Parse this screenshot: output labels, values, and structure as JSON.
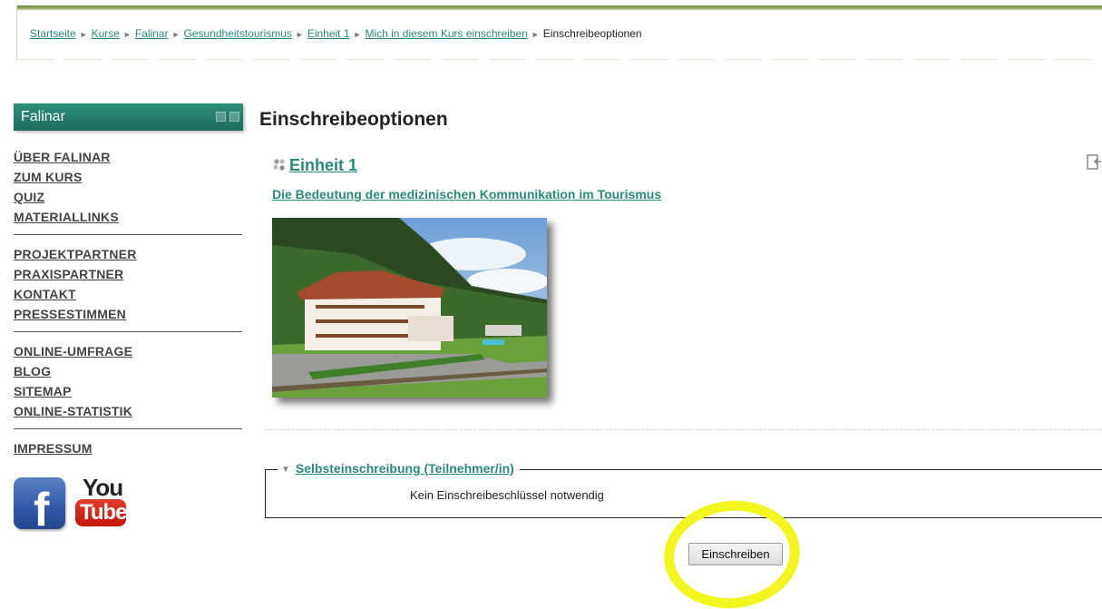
{
  "breadcrumb": {
    "items": [
      "Startseite",
      "Kurse",
      "Falinar",
      "Gesundheitstourismus",
      "Einheit 1",
      "Mich in diesem Kurs einschreiben"
    ],
    "current": "Einschreibeoptionen",
    "separator": "►"
  },
  "sidebar": {
    "title": "Falinar",
    "groups": [
      [
        "ÜBER FALINAR",
        "ZUM KURS",
        "QUIZ",
        "MATERIALLINKS"
      ],
      [
        "PROJEKTPARTNER",
        "PRAXISPARTNER",
        "KONTAKT",
        "PRESSESTIMMEN"
      ],
      [
        "ONLINE-UMFRAGE",
        "BLOG",
        "SITEMAP",
        "ONLINE-STATISTIK"
      ],
      [
        "IMPRESSUM"
      ]
    ],
    "social": {
      "facebook_letter": "f",
      "youtube_you": "You",
      "youtube_tube": "Tube",
      "facebook_icon": "facebook-icon",
      "youtube_icon": "youtube-icon"
    }
  },
  "main": {
    "title": "Einschreibeoptionen",
    "course": {
      "name": "Einheit 1",
      "summary": "Die Bedeutung der medizinischen Kommunikation im Tourismus",
      "icon": "course-icon",
      "image_subject": "hotel-in-mountains"
    },
    "enrolment": {
      "legend": "Selbsteinschreibung (Teilnehmer/in)",
      "info": "Kein Einschreibeschlüssel notwendig",
      "button_label": "Einschreiben"
    }
  },
  "colors": {
    "link": "#2a8a7a",
    "block_header": "#1d6b5c",
    "highlight": "#f2f51e"
  }
}
